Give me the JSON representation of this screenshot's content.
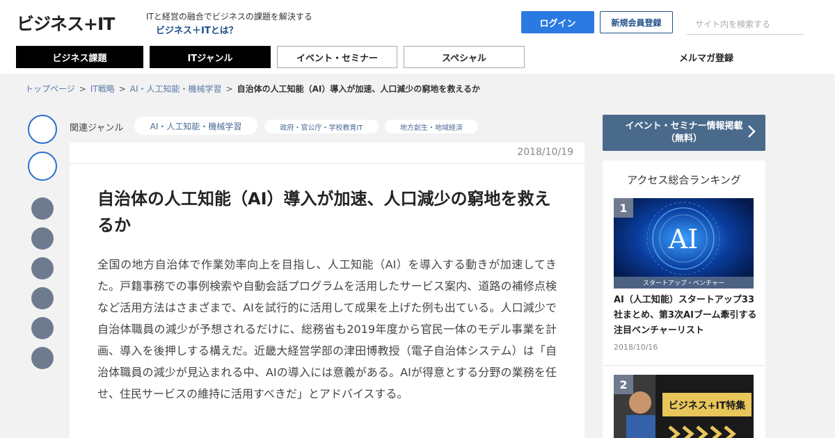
{
  "header": {
    "logo_text": "ビジネス+IT",
    "tagline": "ITと経営の融合でビジネスの課題を解決する",
    "about_link": "ビジネス＋ITとは？",
    "login_label": "ログイン",
    "register_label": "新規会員登録",
    "search_placeholder": "サイト内を検索する"
  },
  "nav": {
    "items": [
      "ビジネス課題",
      "ITジャンル",
      "イベント・セミナー",
      "スペシャル",
      "メルマガ登録"
    ]
  },
  "breadcrumb": {
    "items": [
      "トップページ",
      "IT戦略",
      "AI・人工知能・機械学習"
    ],
    "separator": ">",
    "current": "自治体の人工知能（AI）導入が加速、人口減少の窮地を救えるか"
  },
  "genres": {
    "label": "関連ジャンル",
    "tags": [
      "AI・人工知能・機械学習",
      "政府・官公庁・学校教育IT",
      "地方創生・地域経済"
    ]
  },
  "article": {
    "date": "2018/10/19",
    "title": "自治体の人工知能（AI）導入が加速、人口減少の窮地を救えるか",
    "body": "全国の地方自治体で作業効率向上を目指し、人工知能（AI）を導入する動きが加速してきた。戸籍事務での事例検索や自動会話プログラムを活用したサービス案内、道路の補修点検など活用方法はさまざまで、AIを試行的に活用して成果を上げた例も出ている。人口減少で自治体職員の減少が予想されるだけに、総務省も2019年度から官民一体のモデル事業を計画、導入を後押しする構えだ。近畿大経営学部の津田博教授（電子自治体システム）は「自治体職員の減少が見込まれる中、AIの導入には意義がある。AIが得意とする分野の業務を任せ、住民サービスの維持に活用すべきだ」とアドバイスする。"
  },
  "sidebar": {
    "event_banner": {
      "line1": "イベント・セミナー情報掲載",
      "line2": "（無料）"
    },
    "ranking": {
      "title": "アクセス総合ランキング",
      "items": [
        {
          "rank": "1",
          "image_text": "AI",
          "caption": "スタートアップ・ベンチャー",
          "title": "AI（人工知能）スタートアップ33社まとめ、第3次AIブーム牽引する注目ベンチャーリスト",
          "date": "2018/10/16"
        },
        {
          "rank": "2",
          "image_text": "ビジネス+IT特集"
        }
      ]
    }
  },
  "colors": {
    "brand_blue": "#2a7ae2",
    "navy": "#1f4e89",
    "share_grey": "#6e7b8f",
    "event_banner": "#4a6a8c"
  }
}
